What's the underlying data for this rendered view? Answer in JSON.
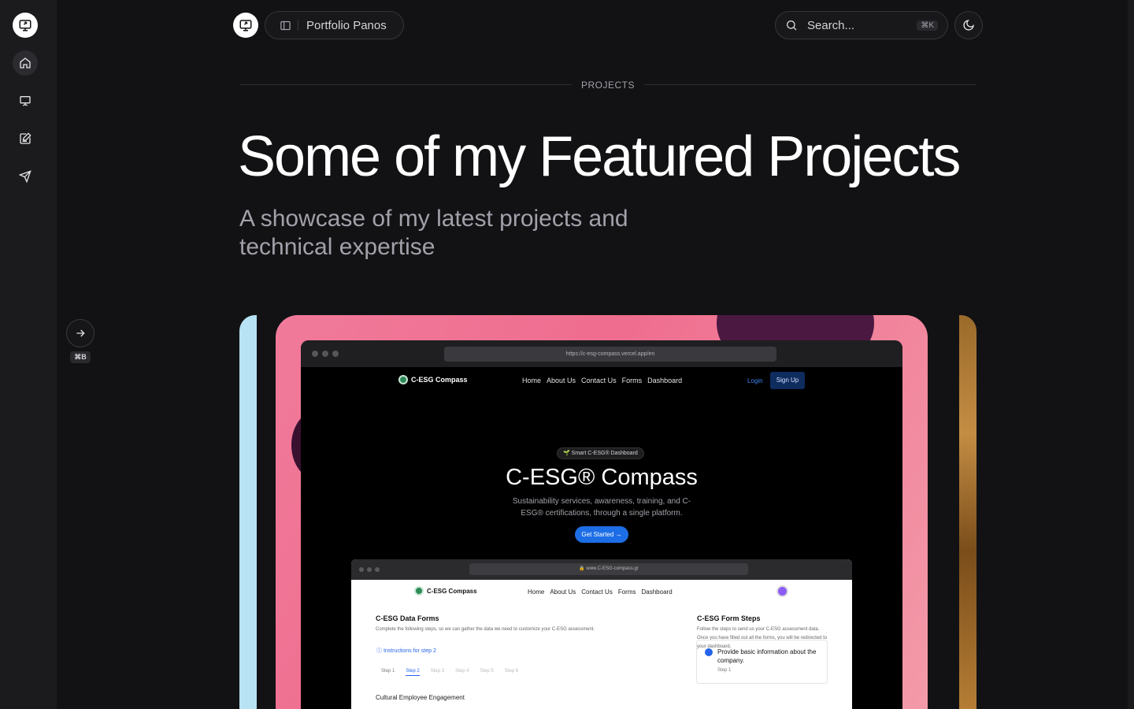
{
  "header": {
    "site_name": "Portfolio Panos",
    "search_placeholder": "Search...",
    "search_shortcut": "⌘K"
  },
  "sidebar": {
    "items": [
      {
        "name": "home",
        "icon": "home-icon"
      },
      {
        "name": "projects",
        "icon": "presentation-icon"
      },
      {
        "name": "blog",
        "icon": "edit-note-icon"
      },
      {
        "name": "contact",
        "icon": "send-icon"
      }
    ],
    "expand_shortcut": "⌘B"
  },
  "page": {
    "section_label": "PROJECTS",
    "title": "Some of my Featured Projects",
    "subtitle": "A showcase of my latest projects and technical expertise"
  },
  "project_preview": {
    "url": "https://c-esg-compass.vercel.app/en",
    "brand": "C-ESG Compass",
    "nav_links": [
      "Home",
      "About Us",
      "Contact Us",
      "Forms",
      "Dashboard"
    ],
    "login": "Login",
    "signup": "Sign Up",
    "badge": "🌱 Smart C-ESG® Dashboard",
    "hero_title": "C-ESG® Compass",
    "hero_desc": "Sustainability services, awareness, training, and C-ESG® certifications, through a single platform.",
    "cta": "Get Started →",
    "inner": {
      "url": "🔒 www.C-ESG-compass.gr",
      "brand": "C-ESG Compass",
      "nav_links": [
        "Home",
        "About Us",
        "Contact Us",
        "Forms",
        "Dashboard"
      ],
      "forms_title": "C-ESG Data Forms",
      "forms_desc": "Complete the following steps, so we can gather the data we need to customize your C-ESG assessment.",
      "instructions": "ⓘ Instructions for step 2",
      "steps": [
        "Step 1",
        "Step 2",
        "Step 3",
        "Step 4",
        "Step 5",
        "Step 6"
      ],
      "section": "Cultural Employee Engagement",
      "side_title": "C-ESG Form Steps",
      "side_desc": "Follow the steps to send us your C-ESG assessment data. Once you have filled out all the forms, you will be redirected to your dashboard.",
      "step_card_title": "Provide basic information about the company.",
      "step_card_sub": "Step 1"
    }
  },
  "colors": {
    "background": "#121214",
    "sidebar": "#1b1b1e",
    "card_pink": "#ef6d8f",
    "accent_blue": "#1d6ee6"
  }
}
